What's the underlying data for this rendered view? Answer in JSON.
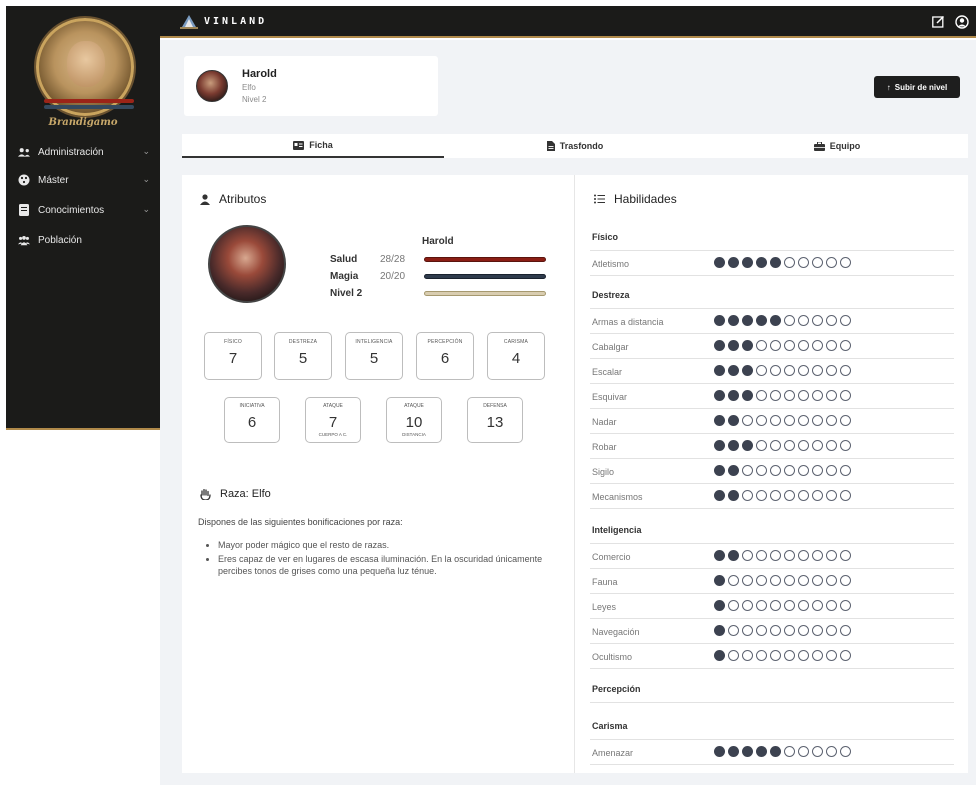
{
  "sidebar": {
    "profile_name": "Brandigamo",
    "items": [
      {
        "label": "Administración",
        "icon": "users-cog-icon",
        "has_chevron": true
      },
      {
        "label": "Máster",
        "icon": "dice-icon",
        "has_chevron": true
      },
      {
        "label": "Conocimientos",
        "icon": "book-icon",
        "has_chevron": true
      },
      {
        "label": "Población",
        "icon": "users-icon",
        "has_chevron": false
      }
    ]
  },
  "topbar": {
    "logo_text": "VINLAND",
    "icons": [
      "edit-icon",
      "user-circle-icon"
    ]
  },
  "character": {
    "name": "Harold",
    "race": "Elfo",
    "level": "Nivel 2"
  },
  "levelup_button": "Subir de nivel",
  "tabs": [
    {
      "label": "Ficha",
      "active": true
    },
    {
      "label": "Trasfondo",
      "active": false
    },
    {
      "label": "Equipo",
      "active": false
    }
  ],
  "attributes": {
    "title": "Atributos",
    "name": "Harold",
    "salud_label": "Salud",
    "salud_value": "28/28",
    "salud_fraction": 1.0,
    "magia_label": "Magia",
    "magia_value": "20/20",
    "magia_fraction": 1.0,
    "nivel_label": "Nivel 2",
    "nivel_fraction": 1.0,
    "colors": {
      "salud": "#8b1e14",
      "magia": "#2f3b4c",
      "nivel": "#d9cdb0"
    },
    "primary": [
      {
        "label": "FÍSICO",
        "value": "7"
      },
      {
        "label": "DESTREZA",
        "value": "5"
      },
      {
        "label": "INTELIGENCIA",
        "value": "5"
      },
      {
        "label": "PERCEPCIÓN",
        "value": "6"
      },
      {
        "label": "CARISMA",
        "value": "4"
      }
    ],
    "secondary": [
      {
        "label": "INICIATIVA",
        "value": "6",
        "sub": ""
      },
      {
        "label": "ATAQUE",
        "value": "7",
        "sub": "CUERPO A C."
      },
      {
        "label": "ATAQUE",
        "value": "10",
        "sub": "DISTANCIA"
      },
      {
        "label": "DEFENSA",
        "value": "13",
        "sub": ""
      }
    ]
  },
  "race": {
    "title": "Raza: Elfo",
    "intro": "Dispones de las siguientes bonificaciones por raza:",
    "bullets": [
      "Mayor poder mágico que el resto de razas.",
      "Eres capaz de ver en lugares de escasa iluminación. En la oscuridad únicamente percibes tonos de grises como una pequeña luz ténue."
    ]
  },
  "skills": {
    "title": "Habilidades",
    "max": 10,
    "groups": [
      {
        "name": "Físico",
        "items": [
          {
            "name": "Atletismo",
            "value": 5
          }
        ]
      },
      {
        "name": "Destreza",
        "items": [
          {
            "name": "Armas a distancia",
            "value": 5
          },
          {
            "name": "Cabalgar",
            "value": 3
          },
          {
            "name": "Escalar",
            "value": 3
          },
          {
            "name": "Esquivar",
            "value": 3
          },
          {
            "name": "Nadar",
            "value": 2
          },
          {
            "name": "Robar",
            "value": 3
          },
          {
            "name": "Sigilo",
            "value": 2
          },
          {
            "name": "Mecanismos",
            "value": 2
          }
        ]
      },
      {
        "name": "Inteligencia",
        "items": [
          {
            "name": "Comercio",
            "value": 2
          },
          {
            "name": "Fauna",
            "value": 1
          },
          {
            "name": "Leyes",
            "value": 1
          },
          {
            "name": "Navegación",
            "value": 1
          },
          {
            "name": "Ocultismo",
            "value": 1
          }
        ]
      },
      {
        "name": "Percepción",
        "items": []
      },
      {
        "name": "Carisma",
        "items": [
          {
            "name": "Amenazar",
            "value": 5
          }
        ]
      }
    ]
  }
}
